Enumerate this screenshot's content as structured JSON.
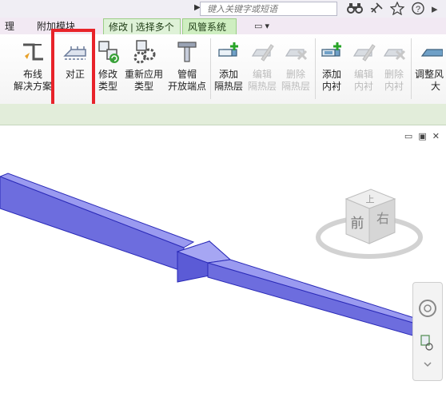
{
  "top": {
    "search_placeholder": "键入关键字或短语",
    "icons": [
      "binoculars-icon",
      "satellite-icon",
      "star-icon",
      "help-icon"
    ]
  },
  "tabs": [
    {
      "label": "理",
      "active": false
    },
    {
      "label": "附加模块",
      "active": false
    },
    {
      "label": "修改 | 选择多个",
      "active": true
    },
    {
      "label": "风管系统",
      "active": true
    },
    {
      "label": "▭ ▾",
      "active": false
    }
  ],
  "ribbon": {
    "buttons": [
      {
        "line1": "布线",
        "line2": "解决方案",
        "enabled": true,
        "icon": "routing-solutions-icon"
      },
      {
        "line1": "对正",
        "line2": "",
        "enabled": true,
        "icon": "justify-icon"
      },
      {
        "line1": "修改",
        "line2": "类型",
        "enabled": true,
        "icon": "change-type-icon"
      },
      {
        "line1": "重新应用",
        "line2": "类型",
        "enabled": true,
        "icon": "reapply-type-icon"
      },
      {
        "line1": "管帽",
        "line2": "开放端点",
        "enabled": true,
        "icon": "cap-open-ends-icon"
      },
      {
        "line1": "添加",
        "line2": "隔热层",
        "enabled": true,
        "icon": "add-insulation-icon"
      },
      {
        "line1": "编辑",
        "line2": "隔热层",
        "enabled": false,
        "icon": "edit-insulation-icon"
      },
      {
        "line1": "删除",
        "line2": "隔热层",
        "enabled": false,
        "icon": "remove-insulation-icon"
      },
      {
        "line1": "添加",
        "line2": "内衬",
        "enabled": true,
        "icon": "add-lining-icon"
      },
      {
        "line1": "编辑",
        "line2": "内衬",
        "enabled": false,
        "icon": "edit-lining-icon"
      },
      {
        "line1": "删除",
        "line2": "内衬",
        "enabled": false,
        "icon": "remove-lining-icon"
      },
      {
        "line1": "调整风",
        "line2": "大",
        "enabled": true,
        "icon": "resize-duct-icon"
      }
    ]
  },
  "viewport": {
    "window_controls": "▭ ▣ ✕",
    "viewcube": {
      "top": "上",
      "front": "前",
      "right": "右"
    },
    "colors": {
      "duct_fill": "#7f7fe6",
      "duct_edge": "#2a2ab8",
      "highlight": "#e8232a",
      "active_tab": "#cfeec1"
    }
  }
}
